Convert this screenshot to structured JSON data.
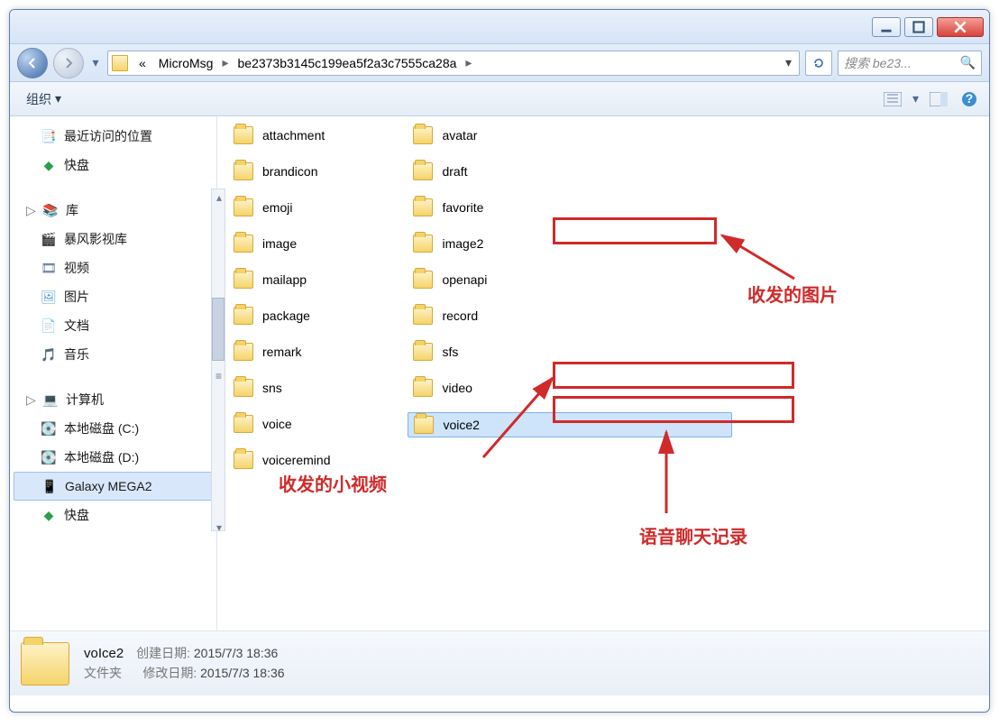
{
  "breadcrumb": {
    "prefix": "«",
    "parent": "MicroMsg",
    "current": "be2373b3145c199ea5f2a3c7555ca28a"
  },
  "search": {
    "placeholder": "搜索 be23..."
  },
  "toolbar": {
    "organize": "组织"
  },
  "sidebar": {
    "recent": "最近访问的位置",
    "kuaipan": "快盘",
    "library": "库",
    "baofeng": "暴风影视库",
    "video": "视频",
    "pictures": "图片",
    "documents": "文档",
    "music": "音乐",
    "computer": "计算机",
    "diskC": "本地磁盘 (C:)",
    "diskD": "本地磁盘 (D:)",
    "galaxy": "Galaxy MEGA2",
    "kuaipan2": "快盘"
  },
  "folders_col1": [
    "attachment",
    "brandicon",
    "emoji",
    "image",
    "mailapp",
    "package",
    "remark",
    "sns",
    "voice",
    "voiceremind"
  ],
  "folders_col2": [
    "avatar",
    "draft",
    "favorite",
    "image2",
    "openapi",
    "record",
    "sfs",
    "video",
    "voice2"
  ],
  "annotations": {
    "images": "收发的图片",
    "smallvideo": "收发的小视频",
    "voicechat": "语音聊天记录"
  },
  "details": {
    "name": "voIce2",
    "type": "文件夹",
    "created_lbl": "创建日期:",
    "created": "2015/7/3 18:36",
    "modified_lbl": "修改日期:",
    "modified": "2015/7/3 18:36"
  }
}
